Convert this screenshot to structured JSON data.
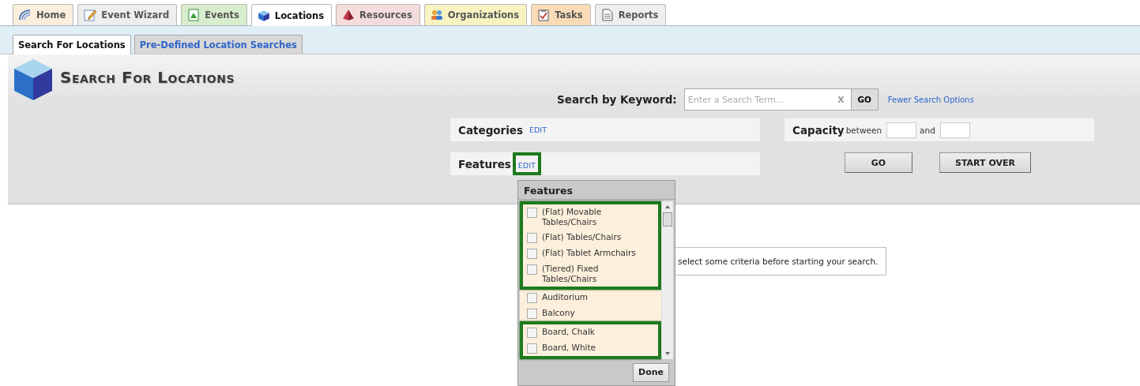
{
  "tabs": [
    {
      "label": "Home",
      "selected": false,
      "color": "#fbeedc"
    },
    {
      "label": "Event Wizard",
      "selected": false,
      "color": "#eeeeee"
    },
    {
      "label": "Events",
      "selected": false,
      "color": "#d8edcc"
    },
    {
      "label": "Locations",
      "selected": true,
      "color": "#ffffff"
    },
    {
      "label": "Resources",
      "selected": false,
      "color": "#f5dcdc"
    },
    {
      "label": "Organizations",
      "selected": false,
      "color": "#f8f3c0"
    },
    {
      "label": "Tasks",
      "selected": false,
      "color": "#f9dbb8"
    },
    {
      "label": "Reports",
      "selected": false,
      "color": "#eeeeee"
    }
  ],
  "subtabs": [
    {
      "label": "Search For Locations",
      "selected": true
    },
    {
      "label": "Pre-Defined Location Searches",
      "selected": false
    }
  ],
  "page_title": "Search For Locations",
  "keyword_search": {
    "label": "Search by Keyword:",
    "placeholder": "Enter a Search Term...",
    "clear": "X",
    "go": "GO",
    "link": "Fewer Search Options"
  },
  "categories": {
    "label": "Categories",
    "edit": "EDIT",
    "highlighted": false
  },
  "capacity": {
    "label": "Capacity",
    "between": "between",
    "and": "and"
  },
  "features": {
    "label": "Features",
    "edit": "EDIT",
    "highlighted": true
  },
  "actions": [
    "GO",
    "START OVER"
  ],
  "message": "select some criteria before starting your search.",
  "features_popup": {
    "title": "Features",
    "done": "Done",
    "items": [
      {
        "label": "(Flat) Movable Tables/Chairs",
        "checked": false,
        "highlighted": true
      },
      {
        "label": "(Flat) Tables/Chairs",
        "checked": false,
        "highlighted": true
      },
      {
        "label": "(Flat) Tablet Armchairs",
        "checked": false,
        "highlighted": true
      },
      {
        "label": "(Tiered) Fixed Tables/Chairs",
        "checked": false,
        "highlighted": true
      },
      {
        "label": "Auditorium",
        "checked": false,
        "highlighted": false
      },
      {
        "label": "Balcony",
        "checked": false,
        "highlighted": false
      },
      {
        "label": "Board, Chalk",
        "checked": false,
        "highlighted": true
      },
      {
        "label": "Board, White",
        "checked": false,
        "highlighted": true
      }
    ]
  }
}
